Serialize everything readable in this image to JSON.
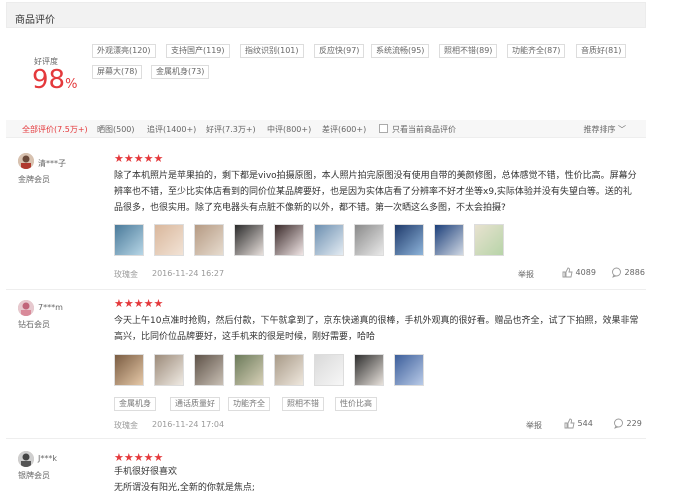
{
  "header": {
    "title": "商品评价"
  },
  "rating": {
    "label": "好评度",
    "value": "98",
    "unit": "%"
  },
  "tags": [
    "外观漂亮(120)",
    "支持国产(119)",
    "指纹识别(101)",
    "反应快(97)",
    "系统流畅(95)",
    "照相不错(89)",
    "功能齐全(87)",
    "音质好(81)",
    "屏幕大(78)",
    "金属机身(73)"
  ],
  "filters": {
    "items": [
      "全部评价(7.5万+)",
      "晒图(500)",
      "追评(1400+)",
      "好评(7.3万+)",
      "中评(800+)",
      "差评(600+)"
    ],
    "only_current": "只看当前商品评价",
    "sort": "推荐排序"
  },
  "reviews": [
    {
      "user": "清***子",
      "level": "金牌会员",
      "stars": "★★★★★",
      "text": "除了本机照片是苹果拍的，剩下都是vivo拍摄原图，本人照片拍完原图没有使用自带的美颜修图，总体感觉不错，性价比高。屏幕分辨率也不错，至少比实体店看到的同价位某品牌要好，也是因为实体店看了分辨率不好才坐等x9,实际体验并没有失望白等。送的礼品很多，也很实用。除了充电器头有点脏不像新的以外，都不错。第一次晒这么多图，不太会拍摄?",
      "tags": [],
      "color": "玫瑰金",
      "date": "2016-11-24 16:27",
      "report": "举报",
      "likes": "4089",
      "comments": "2886"
    },
    {
      "user": "7***m",
      "level": "钻石会员",
      "stars": "★★★★★",
      "text": "今天上午10点准时抢购，然后付款，下午就拿到了，京东快递真的很棒，手机外观真的很好看。赠品也齐全，试了下拍照，效果非常高兴，比同价位品牌要好，这手机来的很是时候，刚好需要，哈哈",
      "tags": [
        "金属机身",
        "通话质量好",
        "功能齐全",
        "照相不错",
        "性价比高"
      ],
      "color": "玫瑰金",
      "date": "2016-11-24 17:04",
      "report": "举报",
      "likes": "544",
      "comments": "229"
    },
    {
      "user": "J***k",
      "level": "银牌会员",
      "stars": "★★★★★",
      "text": "手机很好很喜欢\n无所谓没有阳光,全新的你就是焦点;",
      "tags": [],
      "color": "",
      "date": "",
      "report": "",
      "likes": "",
      "comments": ""
    }
  ],
  "colors": {
    "accent": "#e4393c"
  }
}
